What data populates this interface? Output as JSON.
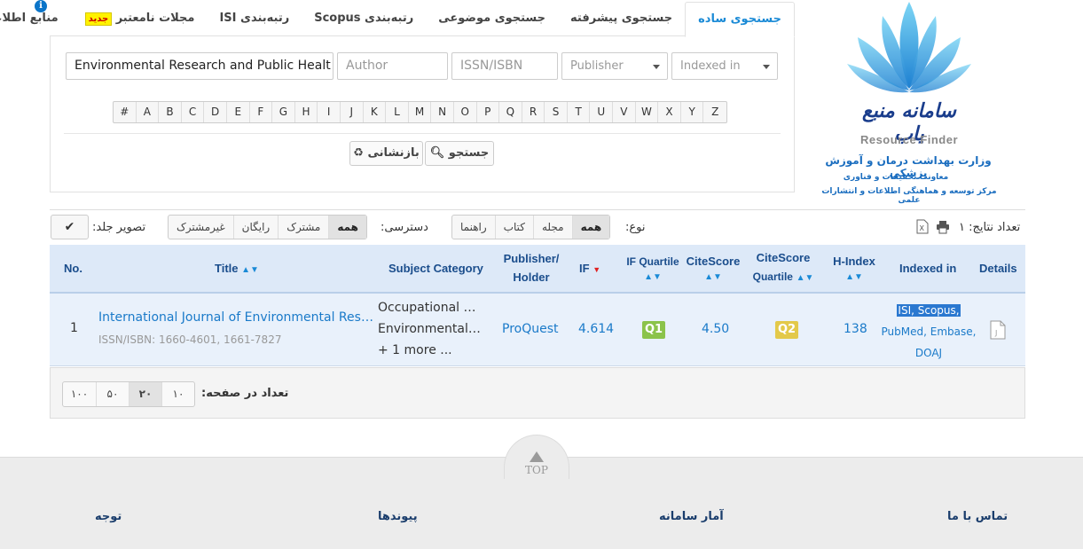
{
  "info_icon": "info-icon",
  "tabs": [
    {
      "label": "جستجوی ساده",
      "active": true
    },
    {
      "label": "جستجوی پیشرفته",
      "active": false
    },
    {
      "label": "جستجوی موضوعی",
      "active": false
    },
    {
      "label": "رتبه‌بندی Scopus",
      "active": false
    },
    {
      "label": "رتبه‌بندی ISI",
      "active": false
    },
    {
      "label": "مجلات نامعتبر",
      "badge": "جدید",
      "active": false
    },
    {
      "label": "منابع اطلاعاتی",
      "active": false
    }
  ],
  "search": {
    "title_value": "Environmental Research and Public Healt",
    "author_placeholder": "Author",
    "issn_placeholder": "ISSN/ISBN",
    "publisher_placeholder": "Publisher",
    "indexed_placeholder": "Indexed in"
  },
  "alphabet": [
    "#",
    "A",
    "B",
    "C",
    "D",
    "E",
    "F",
    "G",
    "H",
    "I",
    "J",
    "K",
    "L",
    "M",
    "N",
    "O",
    "P",
    "Q",
    "R",
    "S",
    "T",
    "U",
    "V",
    "W",
    "X",
    "Y",
    "Z"
  ],
  "buttons": {
    "search": "جستجو",
    "reset": "بازنشانی"
  },
  "logo": {
    "title_fa": "سامانه منبع یاب",
    "title_en": "Resource Finder",
    "line1": "وزارت بهداشت درمان و آموزش پزشکی",
    "line2": "معاونت تحقیقات و فناوری",
    "line3": "مرکز توسعه و هماهنگی اطلاعات و انتشارات علمی",
    "brand_color": "#1a6dbf"
  },
  "results": {
    "count_label": "تعداد نتایج: ۱",
    "type_label": "نوع:",
    "types": [
      {
        "label": "همه",
        "on": true
      },
      {
        "label": "مجله",
        "on": false
      },
      {
        "label": "کتاب",
        "on": false
      },
      {
        "label": "راهنما",
        "on": false
      }
    ],
    "access_label": "دسترسی:",
    "access": [
      {
        "label": "همه",
        "on": true
      },
      {
        "label": "مشترک",
        "on": false
      },
      {
        "label": "رایگان",
        "on": false
      },
      {
        "label": "غیرمشترک",
        "on": false
      }
    ],
    "cover_label": "تصویر جلد:"
  },
  "table": {
    "headers": {
      "no": "No.",
      "title": "Title",
      "subject": "Subject Category",
      "publisher_1": "Publisher/",
      "publisher_2": "Holder",
      "if": "IF",
      "if_quartile": "IF Quartile",
      "citescore": "CiteScore",
      "cs_quartile_1": "CiteScore",
      "cs_quartile_2": "Quartile",
      "hindex": "H-Index",
      "indexed": "Indexed in",
      "details": "Details"
    },
    "rows": [
      {
        "no": "1",
        "title": "International Journal of Environmental Research and Public Health",
        "issn": "ISSN/ISBN: 1660-4601, 1661-7827",
        "subject_1": "Occupational Medicine",
        "subject_2": "Environmental Engineering",
        "subject_more": "+ 1 more ...",
        "publisher": "ProQuest",
        "if": "4.614",
        "if_quartile": "Q1",
        "if_quartile_color": "#8bc34a",
        "citescore": "4.50",
        "cs_quartile": "Q2",
        "cs_quartile_color": "#e3c94a",
        "hindex": "138",
        "indexed_1": "ISI, Scopus,",
        "indexed_2": "PubMed, Embase,",
        "indexed_3": "DOAJ"
      }
    ]
  },
  "pager": {
    "label": "تعداد در صفحه:",
    "sizes": [
      {
        "label": "۱۰",
        "on": false
      },
      {
        "label": "۲۰",
        "on": true
      },
      {
        "label": "۵۰",
        "on": false
      },
      {
        "label": "۱۰۰",
        "on": false
      }
    ]
  },
  "footer": {
    "top": "TOP",
    "contact": "تماس با ما",
    "stats": "آمار سامانه",
    "links": "پیوندها",
    "notice": "توجه"
  }
}
